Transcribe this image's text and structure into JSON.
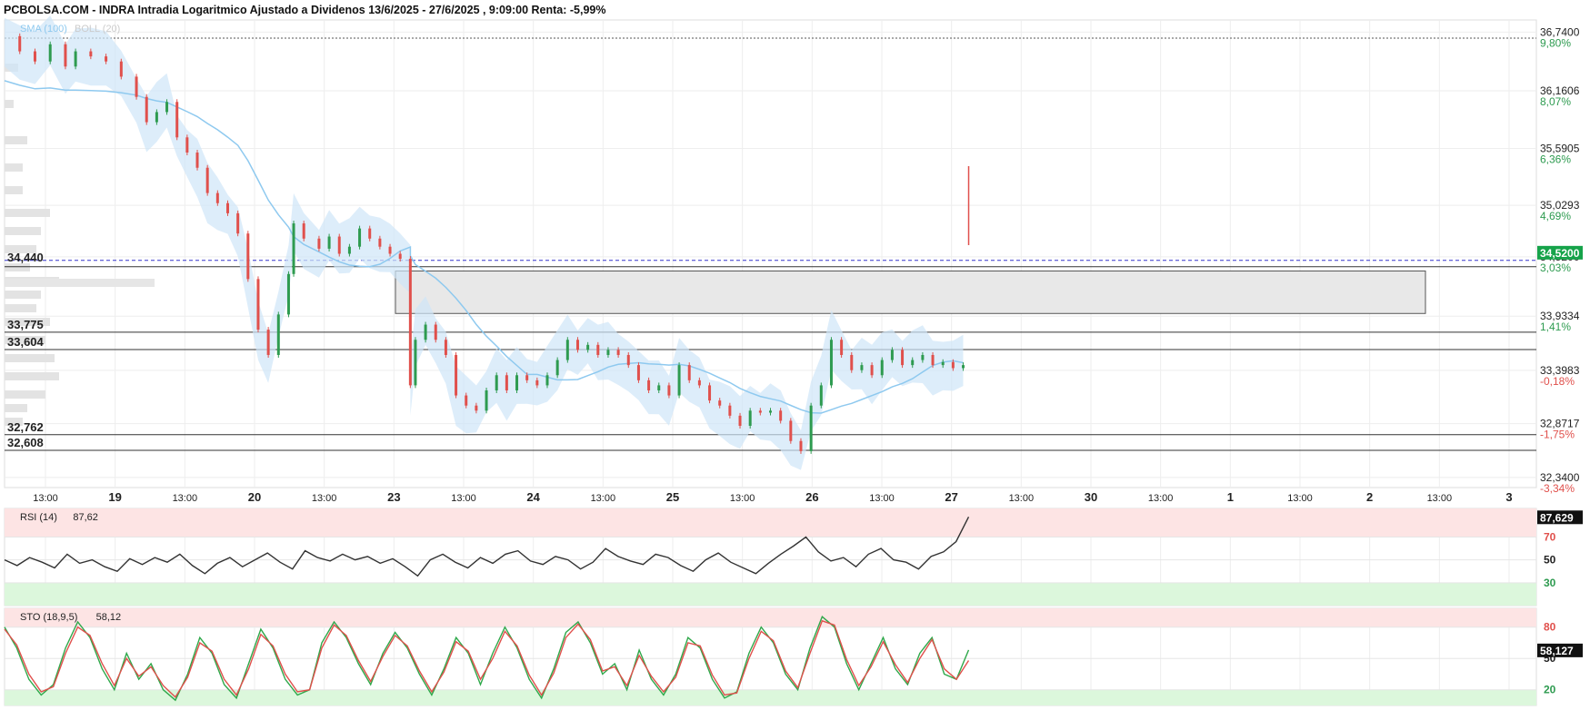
{
  "title": "PCBOLSA.COM - INDRA Intradia Logaritmico Ajustado a Dividenos 13/6/2025 - 27/6/2025 , 9:09:00 Renta: -5,99%",
  "colors": {
    "up": "#2e9b50",
    "down": "#e0504c",
    "ma": "#8ec9ef",
    "band": "#cfe6f8",
    "overbought": "#fde4e4",
    "oversold": "#dcf7dc",
    "rsi_line": "#333333",
    "sto_k": "#2ea84a",
    "sto_d": "#e0504c",
    "current": "#3333cc"
  },
  "chart_data": [
    {
      "type": "line",
      "name": "price",
      "indicators": [
        "SMA (100)",
        "BOLL (20)"
      ],
      "x_ticks": [
        "13:00",
        "19",
        "13:00",
        "20",
        "13:00",
        "23",
        "13:00",
        "24",
        "13:00",
        "25",
        "13:00",
        "26",
        "13:00",
        "27",
        "13:00",
        "30",
        "13:00",
        "1",
        "13:00",
        "2",
        "13:00",
        "3"
      ],
      "y_ticks": [
        {
          "price": "36,7400",
          "pct": "9,80%"
        },
        {
          "price": "36,1606",
          "pct": "8,07%"
        },
        {
          "price": "35,5905",
          "pct": "6,36%"
        },
        {
          "price": "35,0293",
          "pct": "4,69%"
        },
        {
          "price": "34,5200",
          "pct": "3,03%"
        },
        {
          "price": "33,9334",
          "pct": "1,41%"
        },
        {
          "price": "33,3983",
          "pct": "-0,18%"
        },
        {
          "price": "32,8717",
          "pct": "-1,75%"
        },
        {
          "price": "32,3400",
          "pct": "-3,34%"
        }
      ],
      "last_price": "34,5200",
      "last_price_value": 34.52,
      "hlines": [
        {
          "label": "34,440",
          "value": 34.44
        },
        {
          "label": "33,775",
          "value": 33.775
        },
        {
          "label": "33,604",
          "value": 33.604
        },
        {
          "label": "32,762",
          "value": 32.762
        },
        {
          "label": "32,608",
          "value": 32.608
        }
      ],
      "zone": {
        "from_day": "23",
        "to_day": "3",
        "top": 34.38,
        "bottom": 33.96
      },
      "ylim": [
        32.24,
        36.86
      ],
      "points": [
        [
          0,
          36.7
        ],
        [
          3,
          36.55
        ],
        [
          6,
          36.45
        ],
        [
          9,
          36.62
        ],
        [
          12,
          36.4
        ],
        [
          14,
          36.55
        ],
        [
          17,
          36.5
        ],
        [
          20,
          36.45
        ],
        [
          23,
          36.3
        ],
        [
          26,
          36.1
        ],
        [
          28,
          35.85
        ],
        [
          30,
          35.95
        ],
        [
          32,
          36.05
        ],
        [
          34,
          35.7
        ],
        [
          36,
          35.55
        ],
        [
          38,
          35.4
        ],
        [
          40,
          35.15
        ],
        [
          42,
          35.05
        ],
        [
          44,
          34.95
        ],
        [
          46,
          34.75
        ],
        [
          48,
          34.3
        ],
        [
          50,
          33.8
        ],
        [
          52,
          33.55
        ],
        [
          54,
          33.95
        ],
        [
          56,
          34.35
        ],
        [
          57,
          34.85
        ],
        [
          59,
          34.7
        ],
        [
          62,
          34.6
        ],
        [
          64,
          34.72
        ],
        [
          66,
          34.55
        ],
        [
          68,
          34.62
        ],
        [
          70,
          34.8
        ],
        [
          72,
          34.7
        ],
        [
          74,
          34.62
        ],
        [
          76,
          34.55
        ],
        [
          78,
          34.5
        ],
        [
          80,
          34.45
        ],
        [
          80,
          33.25
        ],
        [
          81,
          33.7
        ],
        [
          83,
          33.85
        ],
        [
          85,
          33.7
        ],
        [
          87,
          33.55
        ],
        [
          89,
          33.15
        ],
        [
          91,
          33.05
        ],
        [
          93,
          33.0
        ],
        [
          95,
          33.2
        ],
        [
          97,
          33.35
        ],
        [
          99,
          33.2
        ],
        [
          101,
          33.35
        ],
        [
          103,
          33.3
        ],
        [
          105,
          33.25
        ],
        [
          107,
          33.35
        ],
        [
          109,
          33.5
        ],
        [
          111,
          33.7
        ],
        [
          113,
          33.6
        ],
        [
          115,
          33.65
        ],
        [
          117,
          33.55
        ],
        [
          119,
          33.6
        ],
        [
          121,
          33.55
        ],
        [
          123,
          33.45
        ],
        [
          125,
          33.3
        ],
        [
          127,
          33.2
        ],
        [
          129,
          33.25
        ],
        [
          131,
          33.15
        ],
        [
          133,
          33.45
        ],
        [
          135,
          33.3
        ],
        [
          137,
          33.25
        ],
        [
          139,
          33.1
        ],
        [
          141,
          33.05
        ],
        [
          143,
          32.95
        ],
        [
          145,
          32.85
        ],
        [
          147,
          33.0
        ],
        [
          149,
          32.98
        ],
        [
          151,
          33.0
        ],
        [
          153,
          32.9
        ],
        [
          155,
          32.7
        ],
        [
          157,
          32.6
        ],
        [
          159,
          33.05
        ],
        [
          161,
          33.25
        ],
        [
          163,
          33.7
        ],
        [
          165,
          33.55
        ],
        [
          167,
          33.4
        ],
        [
          169,
          33.45
        ],
        [
          171,
          33.35
        ],
        [
          173,
          33.5
        ],
        [
          175,
          33.6
        ],
        [
          177,
          33.45
        ],
        [
          179,
          33.5
        ],
        [
          181,
          33.55
        ],
        [
          183,
          33.45
        ],
        [
          185,
          33.48
        ],
        [
          187,
          33.42
        ],
        [
          189,
          33.45
        ]
      ],
      "x_max": 302
    },
    {
      "type": "line",
      "name": "RSI (14)",
      "label": "RSI (14)",
      "value_label": "87,62",
      "last": "87,629",
      "last_value": 87.629,
      "ylim": [
        10,
        95
      ],
      "levels": [
        {
          "label": "70",
          "value": 70,
          "color": "#e0504c"
        },
        {
          "label": "50",
          "value": 50,
          "color": "#222222"
        },
        {
          "label": "30",
          "value": 30,
          "color": "#2e9b50"
        }
      ],
      "values": [
        50,
        45,
        52,
        48,
        43,
        55,
        47,
        50,
        44,
        40,
        51,
        46,
        52,
        48,
        55,
        45,
        38,
        47,
        52,
        44,
        50,
        56,
        48,
        42,
        58,
        52,
        49,
        55,
        50,
        53,
        47,
        51,
        44,
        36,
        50,
        55,
        48,
        43,
        52,
        47,
        55,
        58,
        49,
        46,
        53,
        50,
        42,
        48,
        60,
        53,
        49,
        46,
        55,
        52,
        45,
        40,
        50,
        56,
        48,
        43,
        38,
        47,
        55,
        62,
        70,
        57,
        49,
        52,
        44,
        55,
        60,
        50,
        48,
        42,
        53,
        57,
        66,
        87.6
      ]
    },
    {
      "type": "line",
      "name": "STO (18,9,5)",
      "label": "STO (18,9,5)",
      "value_label": "58,12",
      "last": "58,127",
      "last_value": 58.127,
      "ylim": [
        5,
        98
      ],
      "levels": [
        {
          "label": "80",
          "value": 80,
          "color": "#e0504c"
        },
        {
          "label": "50",
          "value": 50,
          "color": "#222222"
        },
        {
          "label": "20",
          "value": 20,
          "color": "#2e9b50"
        }
      ],
      "k": [
        80,
        60,
        30,
        15,
        25,
        60,
        85,
        70,
        40,
        20,
        55,
        30,
        45,
        20,
        10,
        35,
        70,
        55,
        25,
        12,
        45,
        78,
        60,
        30,
        15,
        20,
        65,
        85,
        70,
        45,
        25,
        55,
        75,
        60,
        35,
        15,
        40,
        70,
        55,
        25,
        55,
        80,
        60,
        30,
        12,
        40,
        75,
        85,
        65,
        35,
        45,
        20,
        58,
        30,
        15,
        35,
        70,
        60,
        30,
        12,
        18,
        55,
        80,
        65,
        35,
        20,
        60,
        90,
        80,
        45,
        20,
        45,
        70,
        40,
        25,
        55,
        70,
        35,
        30,
        58.1
      ],
      "d": [
        78,
        63,
        35,
        18,
        23,
        55,
        80,
        72,
        45,
        24,
        50,
        33,
        42,
        24,
        13,
        32,
        65,
        57,
        30,
        15,
        40,
        73,
        62,
        35,
        18,
        20,
        60,
        82,
        72,
        48,
        28,
        52,
        72,
        62,
        38,
        18,
        37,
        66,
        57,
        30,
        50,
        76,
        62,
        34,
        15,
        36,
        70,
        83,
        68,
        38,
        42,
        24,
        53,
        33,
        18,
        32,
        65,
        62,
        34,
        15,
        17,
        50,
        76,
        67,
        38,
        22,
        55,
        86,
        82,
        49,
        24,
        42,
        66,
        44,
        27,
        50,
        68,
        40,
        30,
        48
      ]
    }
  ]
}
